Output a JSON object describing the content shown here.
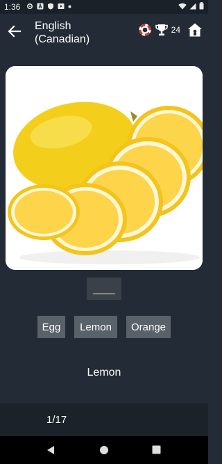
{
  "status_bar": {
    "time": "1:36",
    "icons": [
      "gear-icon",
      "a-icon",
      "shield-icon",
      "media-icon",
      "dot-icon",
      "wifi-icon",
      "signal-icon",
      "battery-icon"
    ]
  },
  "app_bar": {
    "title_line1": "English",
    "title_line2": "(Canadian)",
    "score": "24"
  },
  "quiz": {
    "image_subject": "lemon",
    "blank": "____",
    "options": [
      "Egg",
      "Lemon",
      "Orange"
    ],
    "word": "Lemon"
  },
  "footer": {
    "progress": "1/17"
  },
  "colors": {
    "background": "#232c36",
    "status_bar": "#1a2129",
    "option_bg": "#596169",
    "footer_bg": "#1b222a",
    "lemon_yellow": "#f6d82b"
  }
}
